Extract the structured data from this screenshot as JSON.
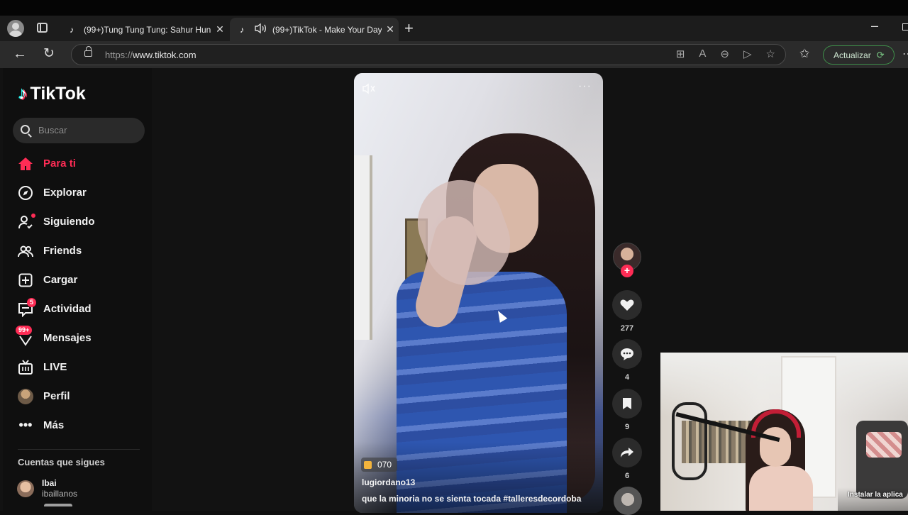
{
  "browser": {
    "tabs": [
      {
        "title": "(99+)Tung Tung Tung: Sahur Hun",
        "favicon": "tiktok-icon",
        "active": false
      },
      {
        "title": "(99+)TikTok - Make Your Day",
        "favicon": "tiktok-icon",
        "active": true,
        "audio": true
      }
    ],
    "url_proto": "https://",
    "url_host": "www.tiktok.com",
    "update_label": "Actualizar"
  },
  "tiktok": {
    "logo_text": "TikTok",
    "search_placeholder": "Buscar",
    "nav": [
      {
        "label": "Para ti",
        "icon": "home-icon",
        "active": true
      },
      {
        "label": "Explorar",
        "icon": "compass-icon"
      },
      {
        "label": "Siguiendo",
        "icon": "following-icon"
      },
      {
        "label": "Friends",
        "icon": "friends-icon"
      },
      {
        "label": "Cargar",
        "icon": "upload-icon"
      },
      {
        "label": "Actividad",
        "icon": "inbox-icon",
        "badge": "5"
      },
      {
        "label": "Mensajes",
        "icon": "message-icon",
        "badge": "99+"
      },
      {
        "label": "LIVE",
        "icon": "live-icon"
      },
      {
        "label": "Perfil",
        "icon": "profile-avatar"
      },
      {
        "label": "Más",
        "icon": "more-icon"
      }
    ],
    "following_title": "Cuentas que sigues",
    "following": [
      {
        "name": "Ibai",
        "username": "ibaillanos"
      }
    ]
  },
  "video": {
    "chip": "070",
    "author": "lugiordano13",
    "caption": "que la minoria no se sienta tocada #talleresdecordoba",
    "actions": {
      "likes": "277",
      "comments": "4",
      "saves": "9",
      "shares": "6"
    }
  },
  "webcam": {
    "overlay_text": "Instalar la aplica"
  },
  "colors": {
    "accent": "#fe2c55",
    "background": "#121212",
    "sidebar": "#0f0f0f",
    "update_border": "#3f8f4a"
  }
}
